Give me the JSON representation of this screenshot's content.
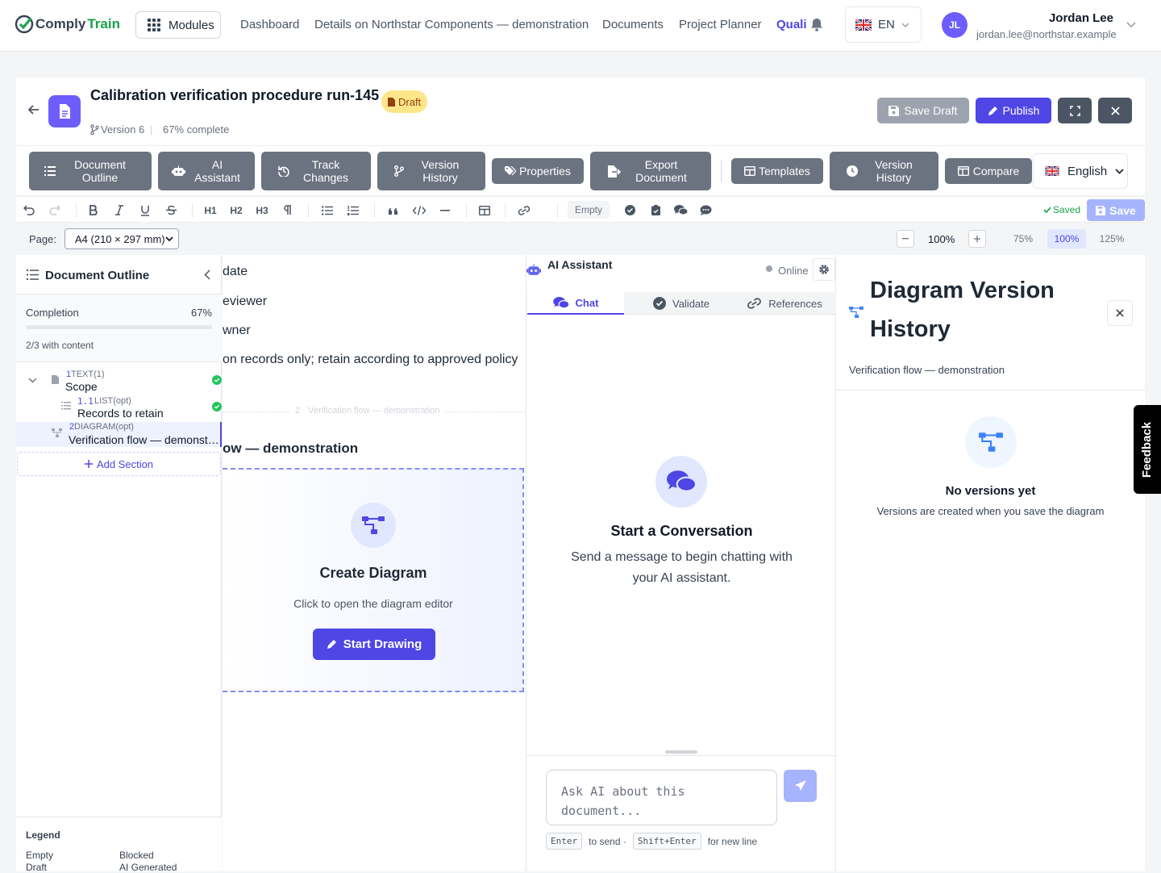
{
  "brand": {
    "name_part1": "Comply",
    "name_part2": "Train"
  },
  "nav": {
    "modules": "Modules",
    "links": [
      "Dashboard",
      "Details on Northstar Components — demonstration",
      "Documents",
      "Project Planner",
      "Quali"
    ],
    "language": "EN",
    "user": {
      "initials": "JL",
      "name": "Jordan Lee",
      "email": "jordan.lee@northstar.example"
    }
  },
  "doc": {
    "title": "Calibration verification procedure run-145",
    "status": "Draft",
    "version": "Version 6",
    "progress": "67% complete",
    "save_draft": "Save Draft",
    "publish": "Publish"
  },
  "toolbar": {
    "outline": "Document Outline",
    "ai": "AI Assistant",
    "track": "Track Changes",
    "version": "Version History",
    "properties": "Properties",
    "export": "Export Document",
    "templates": "Templates",
    "version2": "Version History",
    "compare": "Compare",
    "language": "English"
  },
  "format": {
    "h1": "H1",
    "h2": "H2",
    "h3": "H3",
    "status_chip": "Empty",
    "saved": "Saved",
    "save": "Save"
  },
  "page": {
    "label": "Page:",
    "size": "A4 (210 × 297 mm)",
    "zoom": "100%",
    "zoom_presets": [
      "75%",
      "100%",
      "125%"
    ]
  },
  "outline": {
    "title": "Document Outline",
    "completion_label": "Completion",
    "completion_value": "67%",
    "completion_fraction": 0.67,
    "with_content": "2/3 with content",
    "sections": [
      {
        "num": "1",
        "type": "TEXT(1)",
        "title": "Scope"
      },
      {
        "num": "1.1",
        "type": "LIST(opt)",
        "title": "Records to retain"
      },
      {
        "num": "2",
        "type": "DIAGRAM(opt)",
        "title": "Verification flow — demonst…"
      }
    ],
    "add_section": "Add Section",
    "legend_title": "Legend",
    "legend": [
      "Empty",
      "Blocked",
      "Draft",
      "AI Generated"
    ]
  },
  "document": {
    "lines": [
      "date",
      "eviewer",
      "wner",
      "on records only; retain according to approved policy"
    ],
    "divider_num": "2",
    "divider_label": "Verification flow — demonstration",
    "section_heading": "ow — demonstration",
    "diagram_title": "Create Diagram",
    "diagram_sub": "Click to open the diagram editor",
    "start_drawing": "Start Drawing"
  },
  "ai": {
    "title": "AI Assistant",
    "status": "Online",
    "tabs": [
      "Chat",
      "Validate",
      "References"
    ],
    "empty_title": "Start a Conversation",
    "empty_text": "Send a message to begin chatting with your AI assistant.",
    "placeholder": "Ask AI about this document...",
    "hint_key1": "Enter",
    "hint_text1": "to send ·",
    "hint_key2": "Shift+Enter",
    "hint_text2": "for new line"
  },
  "diagram_history": {
    "title": "Diagram Version History",
    "subtitle": "Verification flow — demonstration",
    "empty_title": "No versions yet",
    "empty_text": "Versions are created when you save the diagram"
  },
  "feedback": "Feedback",
  "colors": {
    "primary": "#4f46e5",
    "accent": "#6d5dfc",
    "toolbar_btn": "#6b7280",
    "success": "#22c55e",
    "draft": "#fde68a"
  }
}
